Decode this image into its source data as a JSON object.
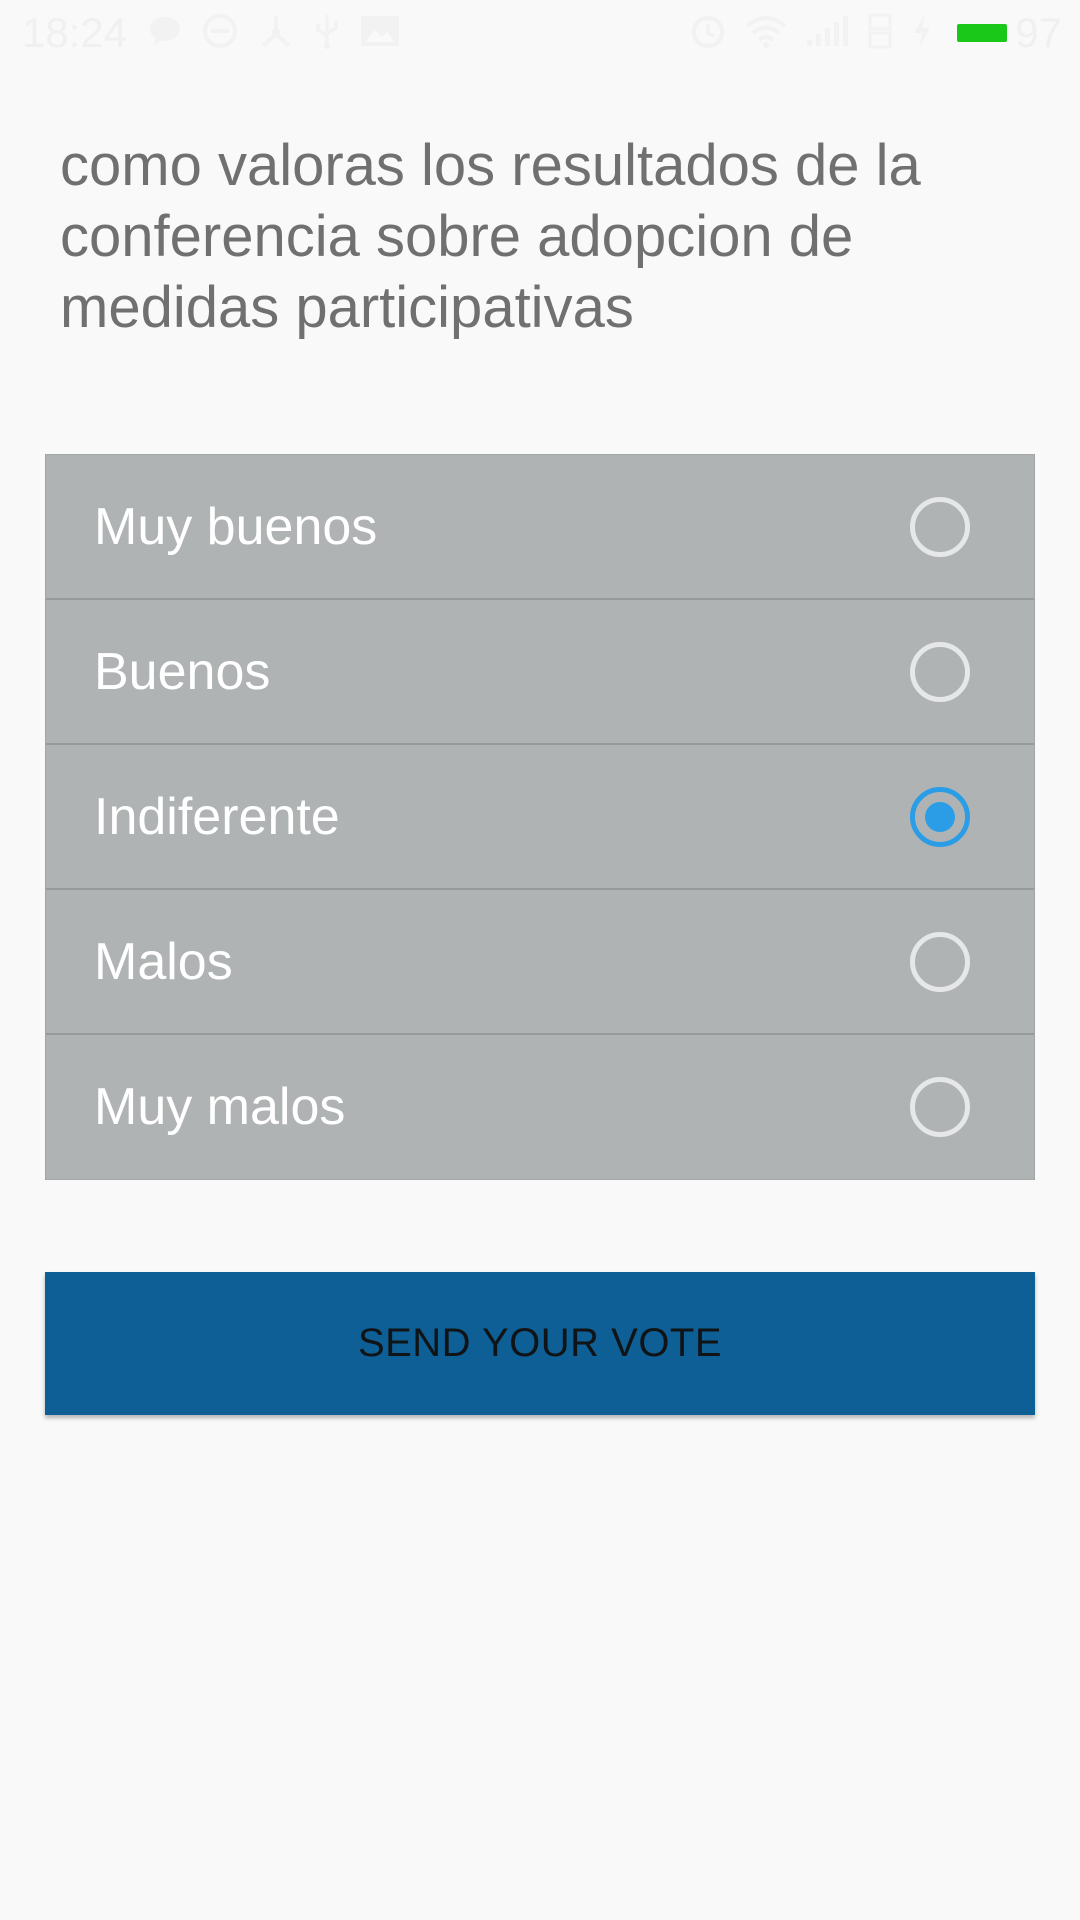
{
  "status_bar": {
    "time": "18:24",
    "battery_level": "97",
    "battery_color": "#19c819",
    "icons_left": [
      "chat-bubble-icon",
      "sync-icon",
      "usb-connection-icon",
      "usb-icon",
      "image-icon"
    ],
    "icons_right": [
      "alarm-icon",
      "wifi-icon",
      "signal-icon",
      "data-4g-icon",
      "charging-icon",
      "battery-icon"
    ]
  },
  "poll": {
    "question": "como valoras los resultados de la conferencia sobre adopcion de medidas participativas",
    "options": [
      {
        "label": "Muy buenos",
        "selected": false
      },
      {
        "label": "Buenos",
        "selected": false
      },
      {
        "label": "Indiferente",
        "selected": true
      },
      {
        "label": "Malos",
        "selected": false
      },
      {
        "label": "Muy malos",
        "selected": false
      }
    ],
    "submit_label": "SEND YOUR VOTE"
  },
  "colors": {
    "background": "#f9f9f9",
    "question_text": "#707070",
    "options_background": "#afb3b4",
    "radio_selected": "#2b9de6",
    "button_background": "#0d5f95"
  }
}
